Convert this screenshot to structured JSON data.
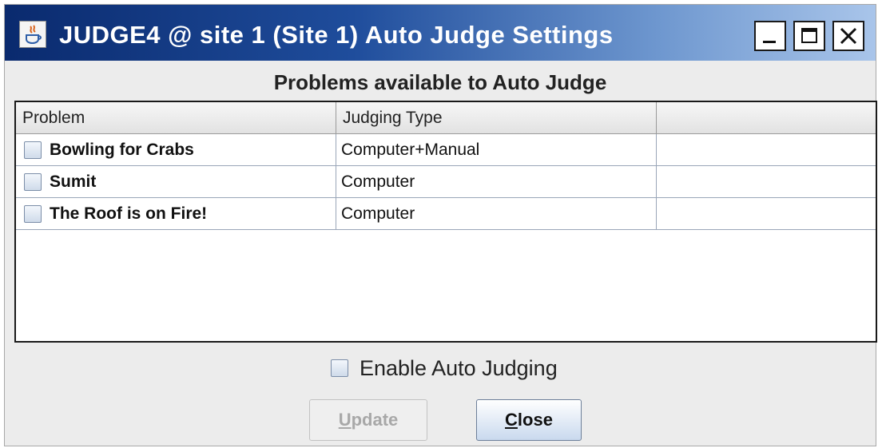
{
  "window": {
    "title": "JUDGE4 @ site 1 (Site 1) Auto Judge Settings",
    "controls": [
      "minimize-icon",
      "maximize-icon",
      "close-icon"
    ]
  },
  "heading": "Problems available to Auto Judge",
  "table": {
    "columns": [
      "Problem",
      "Judging Type",
      ""
    ],
    "rows": [
      {
        "problem": "Bowling for Crabs",
        "judging_type": "Computer+Manual",
        "checked": false
      },
      {
        "problem": "Sumit",
        "judging_type": "Computer",
        "checked": false
      },
      {
        "problem": "The Roof is on Fire!",
        "judging_type": "Computer",
        "checked": false
      }
    ]
  },
  "enable_auto_judging": {
    "label": "Enable Auto Judging",
    "checked": false
  },
  "buttons": {
    "update": {
      "mnemonic": "U",
      "rest": "pdate",
      "enabled": false
    },
    "close": {
      "mnemonic": "C",
      "rest": "lose",
      "enabled": true
    }
  },
  "colors": {
    "titlebar_start": "#0a2a6e",
    "titlebar_end": "#a9c5ea",
    "window_bg": "#ececec"
  }
}
